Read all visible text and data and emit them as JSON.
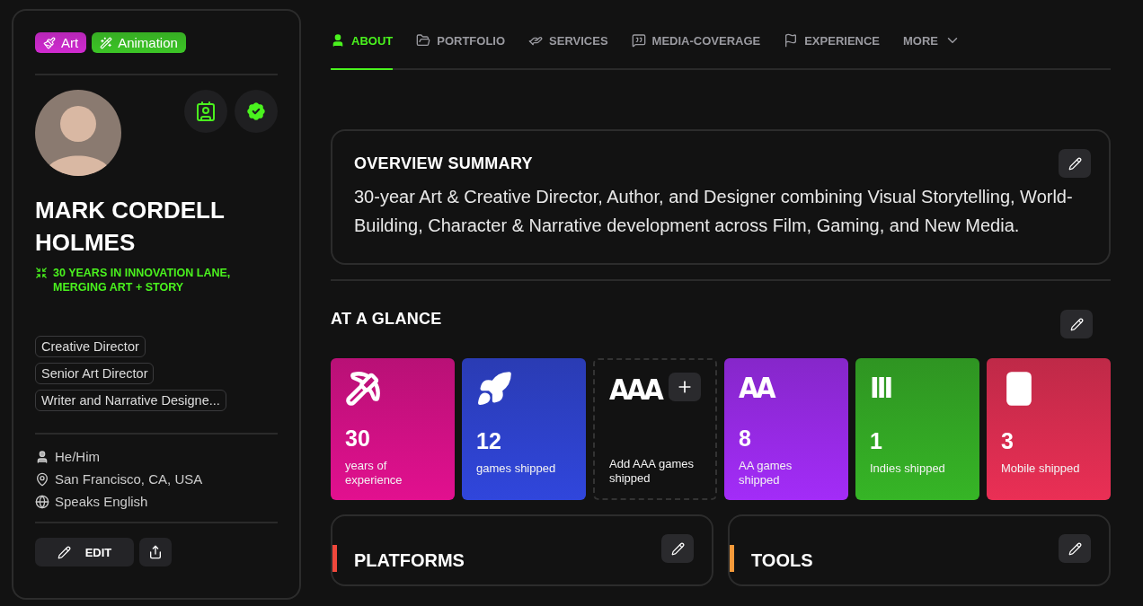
{
  "profile": {
    "tags": [
      {
        "label": "Art",
        "color": "#d02ad0"
      },
      {
        "label": "Animation",
        "color": "#3cc526"
      }
    ],
    "name": "MARK CORDELL HOLMES",
    "tagline": "30 YEARS IN INNOVATION LANE, MERGING ART + STORY",
    "roles": [
      "Creative Director",
      "Senior Art Director",
      "Writer and Narrative Designe..."
    ],
    "details": [
      "He/Him",
      "San Francisco, CA, USA",
      "Speaks English"
    ],
    "edit_button": "EDIT"
  },
  "tabs": [
    {
      "label": "ABOUT",
      "selected": true
    },
    {
      "label": "PORTFOLIO",
      "selected": false
    },
    {
      "label": "SERVICES",
      "selected": false
    },
    {
      "label": "MEDIA-COVERAGE",
      "selected": false
    },
    {
      "label": "EXPERIENCE",
      "selected": false
    },
    {
      "label": "MORE",
      "selected": false
    }
  ],
  "overview": {
    "title": "OVERVIEW SUMMARY",
    "text": "30-year Art & Creative Director, Author, and Designer combining Visual Storytelling, World-Building, Character & Narrative development across Film, Gaming, and New Media."
  },
  "glance": {
    "title": "AT A GLANCE",
    "stats": [
      {
        "kind": "stat",
        "value": "30",
        "label": "years of experience",
        "color": "#e2108f"
      },
      {
        "kind": "stat",
        "value": "12",
        "label": "games shipped",
        "color": "#3046dc"
      },
      {
        "kind": "add",
        "mark": "AAA",
        "label": "Add AAA games shipped"
      },
      {
        "kind": "stat",
        "mark": "AA",
        "value": "8",
        "label": "AA games shipped",
        "color": "#a32cf8"
      },
      {
        "kind": "stat",
        "mark": "III",
        "value": "1",
        "label": "Indies shipped",
        "color": "#36b526"
      },
      {
        "kind": "stat",
        "value": "3",
        "label": "Mobile shipped",
        "color": "#ea2f55"
      }
    ]
  },
  "sections": [
    {
      "title": "PLATFORMS",
      "color": "#f0483c"
    },
    {
      "title": "TOOLS",
      "color": "#f59a3a"
    }
  ]
}
